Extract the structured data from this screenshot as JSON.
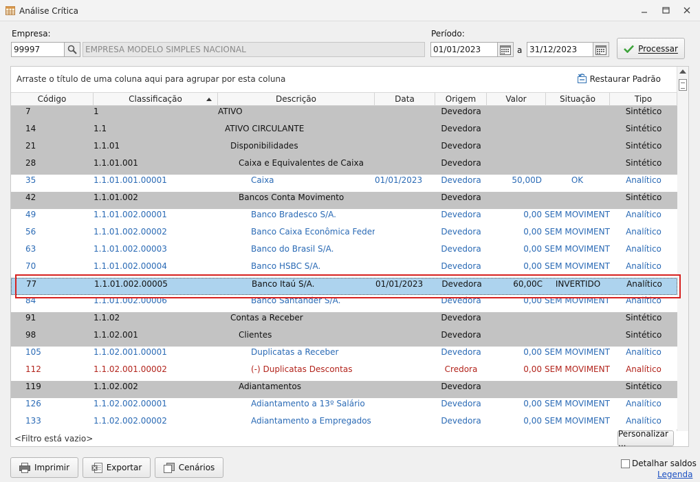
{
  "window": {
    "title": "Análise Crítica"
  },
  "filters": {
    "empresa_label": "Empresa:",
    "empresa_code": "99997",
    "empresa_name": "EMPRESA MODELO SIMPLES NACIONAL",
    "periodo_label": "Período:",
    "date_start": "01/01/2023",
    "date_sep": "a",
    "date_end": "31/12/2023",
    "process_label": "Processar"
  },
  "grid": {
    "group_hint": "Arraste o título de uma coluna aqui para agrupar por esta coluna",
    "restore_label": "Restaurar Padrão",
    "columns": [
      "Código",
      "Classificação",
      "Descrição",
      "Data",
      "Origem",
      "Valor",
      "Situação",
      "Tipo"
    ],
    "rows": [
      {
        "codigo": "7",
        "classificacao": "1",
        "descricao": "ATIVO",
        "data": "",
        "origem": "Devedora",
        "valor": "",
        "situacao": "",
        "tipo": "Sintético",
        "kind": "syn",
        "indent": 0
      },
      {
        "codigo": "14",
        "classificacao": "1.1",
        "descricao": "ATIVO CIRCULANTE",
        "data": "",
        "origem": "Devedora",
        "valor": "",
        "situacao": "",
        "tipo": "Sintético",
        "kind": "syn",
        "indent": 1
      },
      {
        "codigo": "21",
        "classificacao": "1.1.01",
        "descricao": "Disponibilidades",
        "data": "",
        "origem": "Devedora",
        "valor": "",
        "situacao": "",
        "tipo": "Sintético",
        "kind": "syn",
        "indent": 2
      },
      {
        "codigo": "28",
        "classificacao": "1.1.01.001",
        "descricao": "Caixa e Equivalentes de Caixa",
        "data": "",
        "origem": "Devedora",
        "valor": "",
        "situacao": "",
        "tipo": "Sintético",
        "kind": "syn",
        "indent": 3
      },
      {
        "codigo": "35",
        "classificacao": "1.1.01.001.00001",
        "descricao": "Caixa",
        "data": "01/01/2023",
        "origem": "Devedora",
        "valor": "50,00D",
        "situacao": "OK",
        "tipo": "Analítico",
        "kind": "ana",
        "indent": 4
      },
      {
        "codigo": "42",
        "classificacao": "1.1.01.002",
        "descricao": "Bancos Conta Movimento",
        "data": "",
        "origem": "Devedora",
        "valor": "",
        "situacao": "",
        "tipo": "Sintético",
        "kind": "syn",
        "indent": 3
      },
      {
        "codigo": "49",
        "classificacao": "1.1.01.002.00001",
        "descricao": "Banco Bradesco S/A.",
        "data": "",
        "origem": "Devedora",
        "valor": "0,00",
        "situacao": "SEM MOVIMENTO",
        "tipo": "Analítico",
        "kind": "ana",
        "indent": 4
      },
      {
        "codigo": "56",
        "classificacao": "1.1.01.002.00002",
        "descricao": "Banco Caixa Econômica Federal S/A",
        "data": "",
        "origem": "Devedora",
        "valor": "0,00",
        "situacao": "SEM MOVIMENTO",
        "tipo": "Analítico",
        "kind": "ana",
        "indent": 4
      },
      {
        "codigo": "63",
        "classificacao": "1.1.01.002.00003",
        "descricao": "Banco do Brasil S/A.",
        "data": "",
        "origem": "Devedora",
        "valor": "0,00",
        "situacao": "SEM MOVIMENTO",
        "tipo": "Analítico",
        "kind": "ana",
        "indent": 4
      },
      {
        "codigo": "70",
        "classificacao": "1.1.01.002.00004",
        "descricao": "Banco HSBC S/A.",
        "data": "",
        "origem": "Devedora",
        "valor": "0,00",
        "situacao": "SEM MOVIMENTO",
        "tipo": "Analítico",
        "kind": "ana",
        "indent": 4
      },
      {
        "codigo": "77",
        "classificacao": "1.1.01.002.00005",
        "descricao": "Banco Itaú S/A.",
        "data": "01/01/2023",
        "origem": "Devedora",
        "valor": "60,00C",
        "situacao": "INVERTIDO",
        "tipo": "Analítico",
        "kind": "sel",
        "indent": 4
      },
      {
        "codigo": "84",
        "classificacao": "1.1.01.002.00006",
        "descricao": "Banco Santander S/A.",
        "data": "",
        "origem": "Devedora",
        "valor": "0,00",
        "situacao": "SEM MOVIMENTO",
        "tipo": "Analítico",
        "kind": "ana",
        "indent": 4
      },
      {
        "codigo": "91",
        "classificacao": "1.1.02",
        "descricao": "Contas a Receber",
        "data": "",
        "origem": "Devedora",
        "valor": "",
        "situacao": "",
        "tipo": "Sintético",
        "kind": "syn",
        "indent": 2
      },
      {
        "codigo": "98",
        "classificacao": "1.1.02.001",
        "descricao": "Clientes",
        "data": "",
        "origem": "Devedora",
        "valor": "",
        "situacao": "",
        "tipo": "Sintético",
        "kind": "syn",
        "indent": 3
      },
      {
        "codigo": "105",
        "classificacao": "1.1.02.001.00001",
        "descricao": "Duplicatas a Receber",
        "data": "",
        "origem": "Devedora",
        "valor": "0,00",
        "situacao": "SEM MOVIMENTO",
        "tipo": "Analítico",
        "kind": "ana",
        "indent": 4
      },
      {
        "codigo": "112",
        "classificacao": "1.1.02.001.00002",
        "descricao": "(-) Duplicatas Descontas",
        "data": "",
        "origem": "Credora",
        "valor": "0,00",
        "situacao": "SEM MOVIMENTO",
        "tipo": "Analítico",
        "kind": "ana red",
        "indent": 4
      },
      {
        "codigo": "119",
        "classificacao": "1.1.02.002",
        "descricao": "Adiantamentos",
        "data": "",
        "origem": "Devedora",
        "valor": "",
        "situacao": "",
        "tipo": "Sintético",
        "kind": "syn",
        "indent": 3
      },
      {
        "codigo": "126",
        "classificacao": "1.1.02.002.00001",
        "descricao": "Adiantamento a 13º Salário",
        "data": "",
        "origem": "Devedora",
        "valor": "0,00",
        "situacao": "SEM MOVIMENTO",
        "tipo": "Analítico",
        "kind": "ana",
        "indent": 4
      },
      {
        "codigo": "133",
        "classificacao": "1.1.02.002.00002",
        "descricao": "Adiantamento a Empregados",
        "data": "",
        "origem": "Devedora",
        "valor": "0,00",
        "situacao": "SEM MOVIMENTO",
        "tipo": "Analítico",
        "kind": "ana",
        "indent": 4
      }
    ],
    "filter_status": "<Filtro está vazio>",
    "customize_label": "Personalizar ..."
  },
  "actions": {
    "print_label": "Imprimir",
    "export_label": "Exportar",
    "scenarios_label": "Cenários"
  },
  "options": {
    "detail_balances_label": "Detalhar saldos",
    "detail_balances_checked": false,
    "legend_label": "Legenda"
  },
  "colors": {
    "synthetic_row": "#c3c3c3",
    "analytic_text": "#2a6ab5",
    "credit_text": "#b2231b",
    "selected_row": "#add3ee",
    "highlight_border": "#d6211f"
  }
}
